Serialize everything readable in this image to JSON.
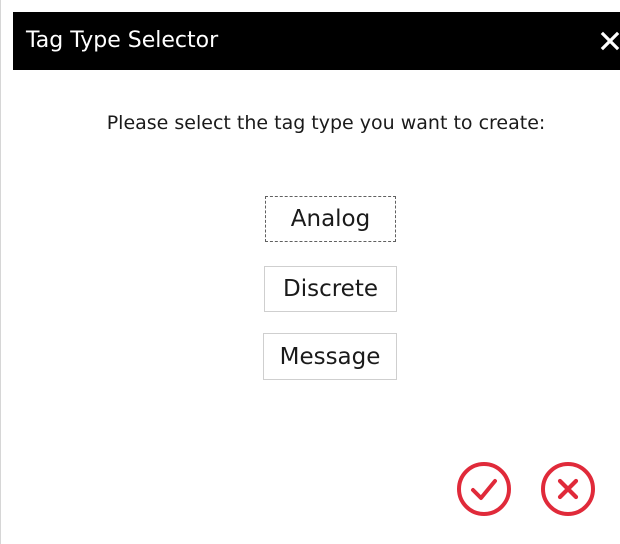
{
  "dialog": {
    "title": "Tag Type Selector",
    "prompt": "Please select the tag type you want to create:",
    "accent_color": "#e02a3a",
    "titlebar_color": "#000000"
  },
  "tag_types": [
    {
      "label": "Analog",
      "focused": true
    },
    {
      "label": "Discrete",
      "focused": false
    },
    {
      "label": "Message",
      "focused": false
    }
  ],
  "actions": {
    "ok_icon": "check-circle-icon",
    "cancel_icon": "x-circle-icon",
    "close_icon": "close-icon"
  }
}
